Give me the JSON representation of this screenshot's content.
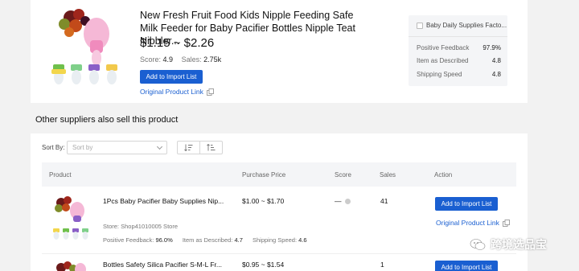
{
  "product": {
    "title": "New Fresh Fruit Food Kids Nipple Feeding Safe Milk Feeder for Baby Pacifier Bottles Nipple Teat Nibbler...",
    "price": "$1.15 ~ $2.26",
    "score_label": "Score:",
    "score": "4.9",
    "sales_label": "Sales:",
    "sales": "2.75k",
    "import_label": "Add to Import List",
    "link_label": "Original Product Link"
  },
  "supplier": {
    "name": "Baby Daily Supplies Facto...",
    "metrics": [
      {
        "label": "Positive Feedback",
        "value": "97.9%"
      },
      {
        "label": "Item as Described",
        "value": "4.8"
      },
      {
        "label": "Shipping Speed",
        "value": "4.8"
      }
    ]
  },
  "section_title": "Other suppliers also sell this product",
  "sort": {
    "label": "Sort By:",
    "placeholder": "Sort by"
  },
  "table": {
    "headers": {
      "product": "Product",
      "price": "Purchase Price",
      "score": "Score",
      "sales": "Sales",
      "action": "Action"
    },
    "rows": [
      {
        "name": "1Pcs Baby Pacifier Baby Supplies Nip...",
        "price": "$1.00 ~ $1.70",
        "score": "—",
        "sales": "41",
        "store": "Store: Shop41010005 Store",
        "pf_label": "Positive Feedback:",
        "pf": "96.0%",
        "iad_label": "Item as Described:",
        "iad": "4.7",
        "ss_label": "Shipping Speed:",
        "ss": "4.6",
        "import_label": "Add to Import List",
        "link_label": "Original Product Link"
      },
      {
        "name": "Bottles Safety Silica Pacifier S-M-L Fr...",
        "price": "$0.95 ~ $1.54",
        "sales": "1",
        "import_label": "Add to Import List"
      }
    ]
  },
  "watermark": "跨境选品宝",
  "colors": {
    "accent": "#1a5fd1",
    "background": "#f2f2f2"
  }
}
